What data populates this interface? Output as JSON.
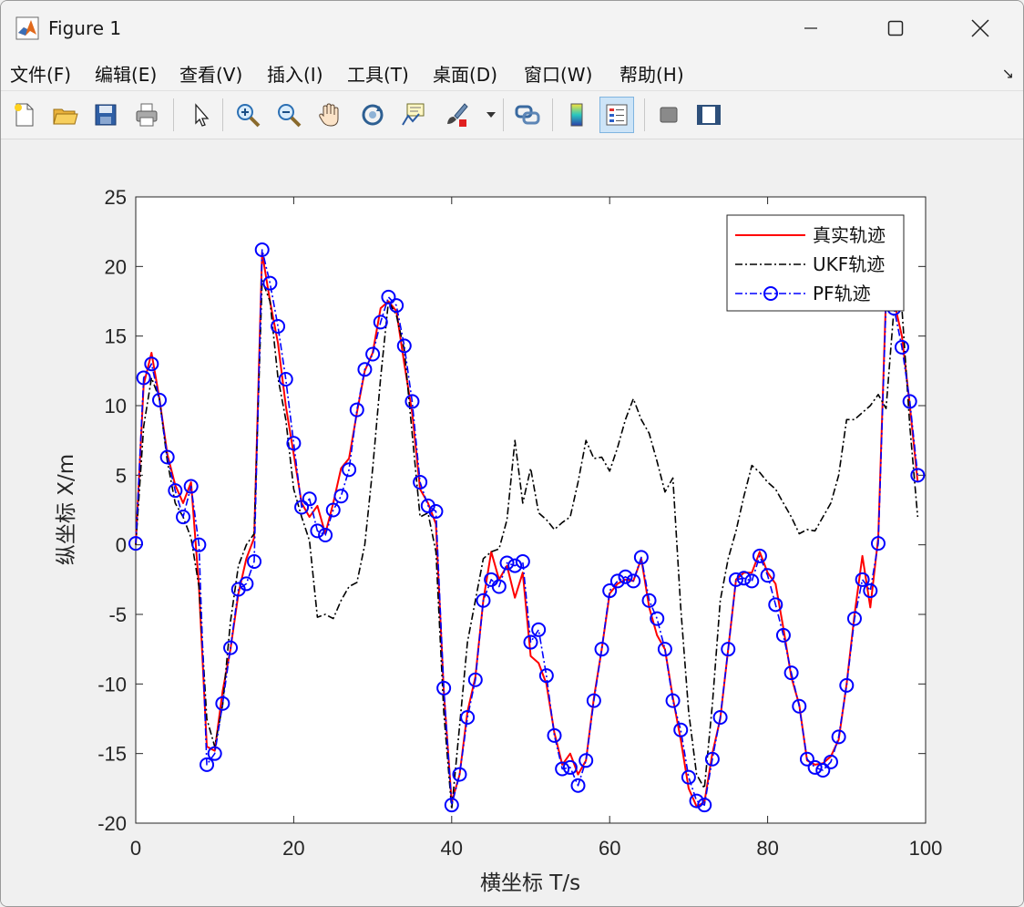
{
  "window": {
    "title": "Figure 1"
  },
  "menu": [
    "文件(F)",
    "编辑(E)",
    "查看(V)",
    "插入(I)",
    "工具(T)",
    "桌面(D)",
    "窗口(W)",
    "帮助(H)"
  ],
  "toolbar": [
    {
      "icon": "new-figure-icon"
    },
    {
      "icon": "open-icon"
    },
    {
      "icon": "save-icon"
    },
    {
      "icon": "print-icon"
    },
    {
      "icon": "edit-plot-arrow-icon"
    },
    {
      "icon": "zoom-in-icon"
    },
    {
      "icon": "zoom-out-icon"
    },
    {
      "icon": "pan-hand-icon"
    },
    {
      "icon": "rotate-3d-icon"
    },
    {
      "icon": "data-cursor-icon"
    },
    {
      "icon": "brush-icon"
    },
    {
      "icon": "link-plot-icon"
    },
    {
      "icon": "colorbar-icon"
    },
    {
      "icon": "legend-icon"
    },
    {
      "icon": "hide-plot-tools-icon"
    },
    {
      "icon": "show-plot-tools-icon"
    }
  ],
  "colors": {
    "true": "#ff0000",
    "ukf": "#000000",
    "pf": "#0000ff"
  },
  "chart_data": {
    "type": "line",
    "xlabel": "横坐标 T/s",
    "ylabel": "纵坐标 X/m",
    "xlim": [
      0,
      100
    ],
    "ylim": [
      -20,
      25
    ],
    "xticks": [
      0,
      20,
      40,
      60,
      80,
      100
    ],
    "yticks": [
      -20,
      -15,
      -10,
      -5,
      0,
      5,
      10,
      15,
      20,
      25
    ],
    "legend_position": "top-right",
    "series": [
      {
        "name": "真实轨迹",
        "style": "solid",
        "x": [
          0,
          1,
          2,
          3,
          4,
          5,
          6,
          7,
          8,
          9,
          10,
          11,
          12,
          13,
          14,
          15,
          16,
          17,
          18,
          19,
          20,
          21,
          22,
          23,
          24,
          25,
          26,
          27,
          28,
          29,
          30,
          31,
          32,
          33,
          34,
          35,
          36,
          37,
          38,
          39,
          40,
          41,
          42,
          43,
          44,
          45,
          46,
          47,
          48,
          49,
          50,
          51,
          52,
          53,
          54,
          55,
          56,
          57,
          58,
          59,
          60,
          61,
          62,
          63,
          64,
          65,
          66,
          67,
          68,
          69,
          70,
          71,
          72,
          73,
          74,
          75,
          76,
          77,
          78,
          79,
          80,
          81,
          82,
          83,
          84,
          85,
          86,
          87,
          88,
          89,
          90,
          91,
          92,
          93,
          94,
          95,
          96,
          97,
          98,
          99
        ],
        "y": [
          0,
          11.5,
          13.8,
          10.5,
          6.5,
          4.3,
          3.0,
          4.5,
          -3.0,
          -14.5,
          -14.8,
          -10.5,
          -7.5,
          -3.5,
          -1.0,
          0.5,
          21.0,
          17.5,
          14.5,
          10.0,
          6.5,
          3.0,
          2.0,
          2.8,
          0.8,
          3.0,
          5.5,
          6.2,
          9.5,
          12.5,
          13.8,
          17.0,
          17.5,
          16.8,
          13.0,
          9.5,
          4.0,
          3.0,
          1.5,
          -10.5,
          -18.5,
          -16.5,
          -12.0,
          -9.5,
          -4.0,
          -0.5,
          -2.5,
          -1.5,
          -3.8,
          -2.0,
          -8.0,
          -8.5,
          -10.0,
          -13.5,
          -15.8,
          -15.0,
          -16.5,
          -15.5,
          -11.0,
          -7.5,
          -3.5,
          -2.8,
          -2.5,
          -2.6,
          -1.0,
          -4.5,
          -6.5,
          -7.5,
          -11.0,
          -14.0,
          -17.5,
          -18.8,
          -18.5,
          -15.0,
          -12.5,
          -7.5,
          -2.5,
          -2.0,
          -2.0,
          -0.5,
          -2.0,
          -2.8,
          -6.0,
          -9.5,
          -11.5,
          -15.5,
          -15.8,
          -15.7,
          -15.2,
          -14.0,
          -10.0,
          -5.0,
          -0.8,
          -4.5,
          0.5,
          18.0,
          17.5,
          15.0,
          10.0,
          4.5
        ]
      },
      {
        "name": "UKF轨迹",
        "style": "dashdot",
        "x": [
          0,
          1,
          2,
          3,
          4,
          5,
          6,
          7,
          8,
          9,
          10,
          11,
          12,
          13,
          14,
          15,
          16,
          17,
          18,
          19,
          20,
          21,
          22,
          23,
          24,
          25,
          26,
          27,
          28,
          29,
          30,
          31,
          32,
          33,
          34,
          35,
          36,
          37,
          38,
          39,
          40,
          41,
          42,
          43,
          44,
          45,
          46,
          47,
          48,
          49,
          50,
          51,
          52,
          53,
          54,
          55,
          56,
          57,
          58,
          59,
          60,
          61,
          62,
          63,
          64,
          65,
          66,
          67,
          68,
          69,
          70,
          71,
          72,
          73,
          74,
          75,
          76,
          77,
          78,
          79,
          80,
          81,
          82,
          83,
          84,
          85,
          86,
          87,
          88,
          89,
          90,
          91,
          92,
          93,
          94,
          95,
          96,
          97,
          98,
          99
        ],
        "y": [
          0,
          8.5,
          12.0,
          10.5,
          6.0,
          3.0,
          2.0,
          0.5,
          -3.0,
          -12.5,
          -14.5,
          -11.5,
          -5.5,
          -1.5,
          0,
          0.8,
          19.0,
          17.5,
          12.0,
          9.0,
          4.0,
          2.0,
          0.3,
          -5.2,
          -5.0,
          -5.3,
          -4.0,
          -3.0,
          -2.7,
          0,
          5.5,
          12.0,
          17.5,
          16.5,
          14.0,
          8.0,
          2.0,
          2.3,
          -0.5,
          -12.0,
          -19.0,
          -13.0,
          -7.0,
          -4.0,
          -1.0,
          -0.5,
          -0.3,
          1.8,
          7.5,
          3.0,
          5.5,
          2.3,
          1.8,
          1.1,
          1.6,
          2.0,
          4.5,
          7.5,
          6.2,
          6.3,
          5.3,
          7.0,
          9.0,
          10.5,
          9.0,
          8.0,
          6.0,
          3.8,
          4.8,
          -4.5,
          -12.0,
          -16.5,
          -17.5,
          -11.5,
          -4.0,
          -1.0,
          1.0,
          3.5,
          5.7,
          5.2,
          4.5,
          4.0,
          3.0,
          2.0,
          0.8,
          1.1,
          1.0,
          2.0,
          3.0,
          5.0,
          9.0,
          9.0,
          9.5,
          10.0,
          10.8,
          9.8,
          17.0,
          17.0,
          8.5,
          2.0
        ]
      },
      {
        "name": "PF轨迹",
        "style": "dashdot-marker",
        "x": [
          0,
          1,
          2,
          3,
          4,
          5,
          6,
          7,
          8,
          9,
          10,
          11,
          12,
          13,
          14,
          15,
          16,
          17,
          18,
          19,
          20,
          21,
          22,
          23,
          24,
          25,
          26,
          27,
          28,
          29,
          30,
          31,
          32,
          33,
          34,
          35,
          36,
          37,
          38,
          39,
          40,
          41,
          42,
          43,
          44,
          45,
          46,
          47,
          48,
          49,
          50,
          51,
          52,
          53,
          54,
          55,
          56,
          57,
          58,
          59,
          60,
          61,
          62,
          63,
          64,
          65,
          66,
          67,
          68,
          69,
          70,
          71,
          72,
          73,
          74,
          75,
          76,
          77,
          78,
          79,
          80,
          81,
          82,
          83,
          84,
          85,
          86,
          87,
          88,
          89,
          90,
          91,
          92,
          93,
          94,
          95,
          96,
          97,
          98,
          99
        ],
        "y": [
          0.1,
          12.0,
          13.0,
          10.4,
          6.3,
          3.9,
          2.0,
          4.2,
          0.0,
          -15.8,
          -15.0,
          -11.4,
          -7.4,
          -3.2,
          -2.8,
          -1.2,
          21.2,
          18.8,
          15.7,
          11.9,
          7.3,
          2.7,
          3.3,
          1.0,
          0.7,
          2.5,
          3.5,
          5.4,
          9.7,
          12.6,
          13.7,
          16.0,
          17.8,
          17.2,
          14.3,
          10.3,
          4.5,
          2.8,
          2.4,
          -10.3,
          -18.7,
          -16.5,
          -12.4,
          -9.7,
          -4.0,
          -2.5,
          -3.0,
          -1.3,
          -1.5,
          -1.2,
          -7.0,
          -6.1,
          -9.4,
          -13.7,
          -16.1,
          -16.0,
          -17.3,
          -15.5,
          -11.2,
          -7.5,
          -3.3,
          -2.6,
          -2.3,
          -2.6,
          -0.9,
          -4.0,
          -5.3,
          -7.5,
          -11.2,
          -13.3,
          -16.7,
          -18.4,
          -18.7,
          -15.4,
          -12.4,
          -7.5,
          -2.5,
          -2.4,
          -2.6,
          -0.8,
          -2.2,
          -4.3,
          -6.5,
          -9.2,
          -11.6,
          -15.4,
          -16.0,
          -16.2,
          -15.6,
          -13.8,
          -10.1,
          -5.3,
          -2.5,
          -3.3,
          0.1,
          17.5,
          17.0,
          14.2,
          10.3,
          5.0
        ]
      }
    ]
  }
}
